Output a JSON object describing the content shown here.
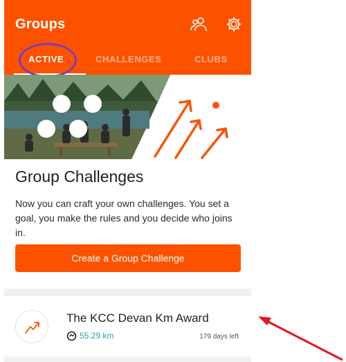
{
  "header": {
    "title": "Groups",
    "icons": [
      "friends-icon",
      "gear-icon"
    ],
    "accent_color": "#fc5200"
  },
  "tabs": [
    {
      "label": "ACTIVE",
      "active": true
    },
    {
      "label": "CHALLENGES",
      "active": false
    },
    {
      "label": "CLUBS",
      "active": false
    }
  ],
  "promo": {
    "heading": "Group Challenges",
    "description": "Now you can craft your own challenges. You set a goal, you make the rules and you decide who joins in.",
    "cta_label": "Create a Group Challenge"
  },
  "challenges": [
    {
      "title": "The KCC Devan Km Award",
      "distance": "55.29 km",
      "days_left": "179 days left",
      "icon": "trend-arrow-icon",
      "distance_color": "#29a3a3"
    }
  ],
  "annotations": {
    "highlight_color": "#7a3fb4",
    "arrow_color": "#e8141c"
  }
}
